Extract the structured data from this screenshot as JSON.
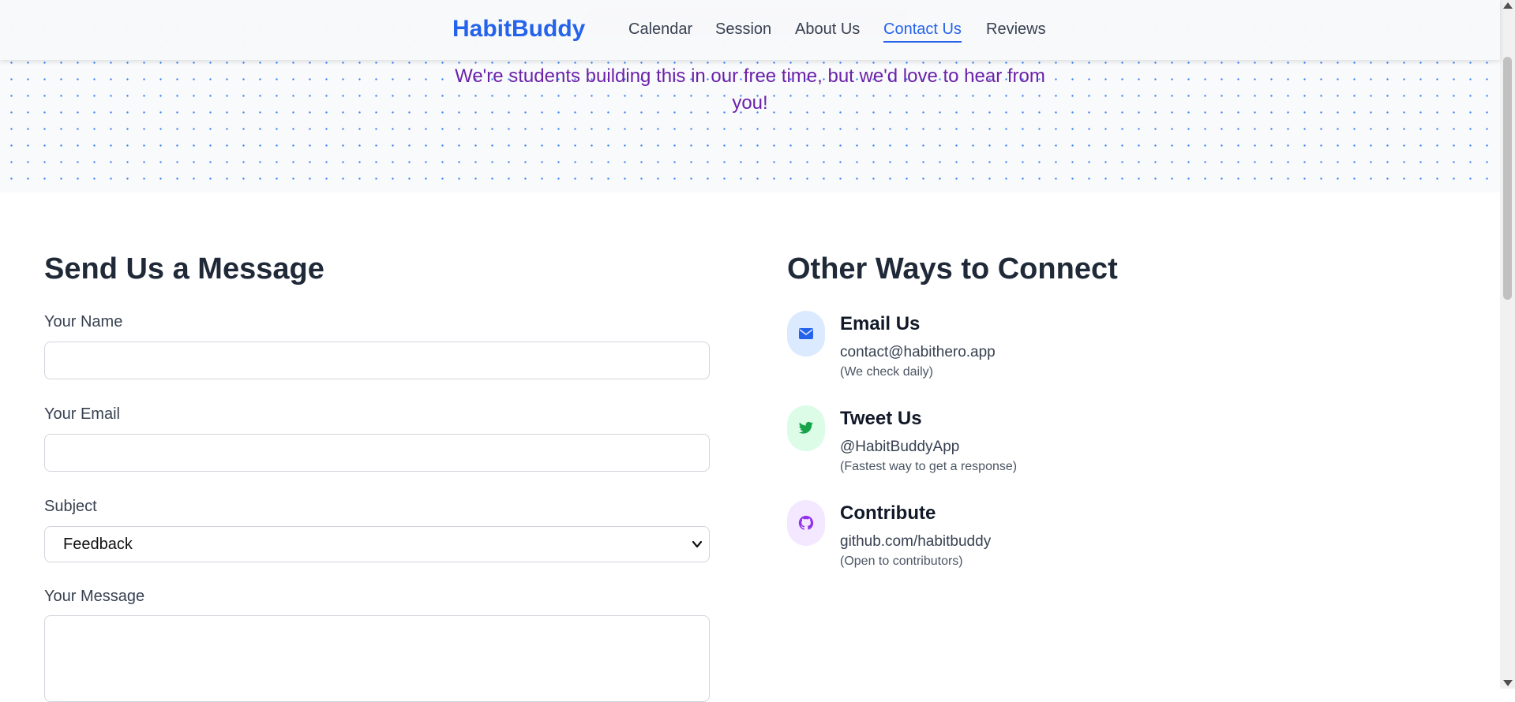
{
  "brand": "HabitBuddy",
  "nav": {
    "items": [
      {
        "label": "Calendar"
      },
      {
        "label": "Session"
      },
      {
        "label": "About Us"
      },
      {
        "label": "Contact Us",
        "active": true
      },
      {
        "label": "Reviews"
      }
    ]
  },
  "hero": {
    "tagline_line1": "We're students building this in our free time, but we'd love to hear from",
    "tagline_line2": "you!"
  },
  "form": {
    "title": "Send Us a Message",
    "name_label": "Your Name",
    "name_value": "",
    "email_label": "Your Email",
    "email_value": "",
    "subject_label": "Subject",
    "subject_value": "Feedback",
    "message_label": "Your Message",
    "message_value": ""
  },
  "contact": {
    "title": "Other Ways to Connect",
    "items": [
      {
        "icon": "envelope-icon",
        "title": "Email Us",
        "value": "contact@habithero.app",
        "note": "(We check daily)",
        "color": "#2563eb",
        "bg": "#dbeafe"
      },
      {
        "icon": "twitter-icon",
        "title": "Tweet Us",
        "value": "@HabitBuddyApp",
        "note": "(Fastest way to get a response)",
        "color": "#16a34a",
        "bg": "#dcfce7"
      },
      {
        "icon": "github-icon",
        "title": "Contribute",
        "value": "github.com/habitbuddy",
        "note": "(Open to contributors)",
        "color": "#9333ea",
        "bg": "#f3e8ff"
      }
    ]
  },
  "colors": {
    "accent": "#2563eb",
    "tagline": "#6b21a8",
    "heading": "#1f2937"
  }
}
